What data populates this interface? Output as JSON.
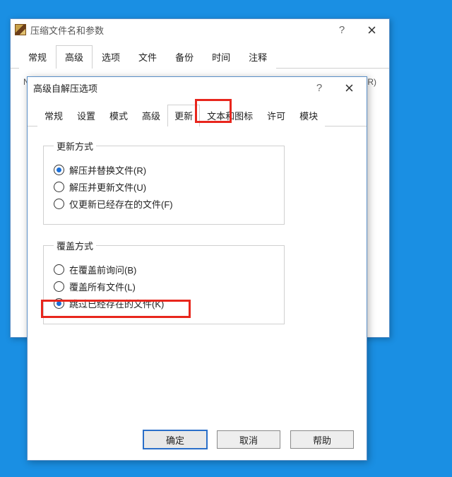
{
  "back": {
    "title": "压缩文件名和参数",
    "help": "?",
    "tabs": [
      "常规",
      "高级",
      "选项",
      "文件",
      "备份",
      "时间",
      "注释"
    ],
    "active_tab": 1,
    "body_left": "NTFS 选项",
    "body_right": "恢复记录(R)"
  },
  "front": {
    "title": "高级自解压选项",
    "help": "?",
    "tabs": [
      "常规",
      "设置",
      "模式",
      "高级",
      "更新",
      "文本和图标",
      "许可",
      "模块"
    ],
    "active_tab": 4,
    "group1": {
      "legend": "更新方式",
      "opts": [
        {
          "label": "解压并替换文件(R)",
          "checked": true
        },
        {
          "label": "解压并更新文件(U)",
          "checked": false
        },
        {
          "label": "仅更新已经存在的文件(F)",
          "checked": false
        }
      ]
    },
    "group2": {
      "legend": "覆盖方式",
      "opts": [
        {
          "label": "在覆盖前询问(B)",
          "checked": false
        },
        {
          "label": "覆盖所有文件(L)",
          "checked": false
        },
        {
          "label": "跳过已经存在的文件(K)",
          "checked": true
        }
      ]
    },
    "buttons": {
      "ok": "确定",
      "cancel": "取消",
      "help": "帮助"
    }
  }
}
